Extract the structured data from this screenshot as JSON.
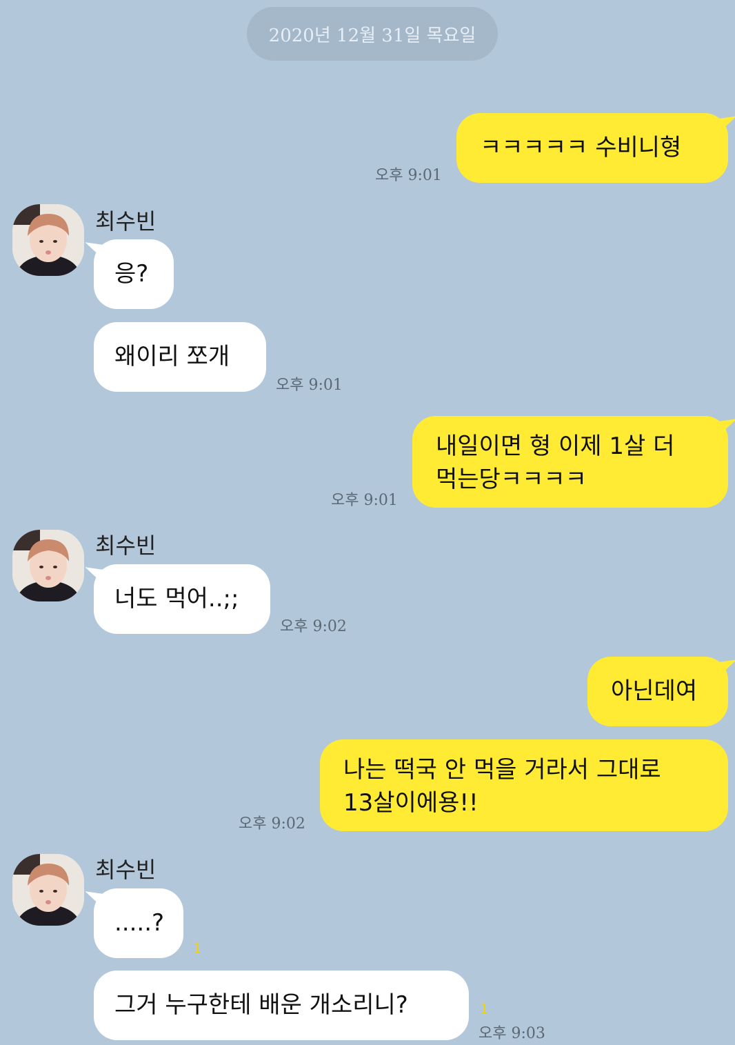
{
  "date_divider": "2020년 12월 31일 목요일",
  "sender_name": "최수빈",
  "messages": [
    {
      "from": "me",
      "text": "ㅋㅋㅋㅋㅋ 수비니형",
      "time": "오후 9:01"
    },
    {
      "from": "other",
      "text": "응?"
    },
    {
      "from": "other",
      "text": "왜이리 쪼개",
      "time": "오후 9:01"
    },
    {
      "from": "me",
      "lines": [
        "내일이면 형 이제 1살 더",
        "먹는당ㅋㅋㅋㅋ"
      ],
      "time": "오후 9:01"
    },
    {
      "from": "other",
      "text": "너도 먹어..;;",
      "time": "오후 9:02"
    },
    {
      "from": "me",
      "text": "아닌데여"
    },
    {
      "from": "me",
      "lines": [
        "나는 떡국 안 먹을 거라서 그대로",
        "13살이에용!!"
      ],
      "time": "오후 9:02"
    },
    {
      "from": "other",
      "text": ".....?",
      "unread": "1"
    },
    {
      "from": "other",
      "text": "그거 누구한테 배운 개소리니?",
      "unread": "1",
      "time": "오후 9:03"
    }
  ],
  "colors": {
    "background": "#b2c7da",
    "my_bubble": "#ffeb33",
    "other_bubble": "#ffffff",
    "unread_count": "#f2d400"
  }
}
